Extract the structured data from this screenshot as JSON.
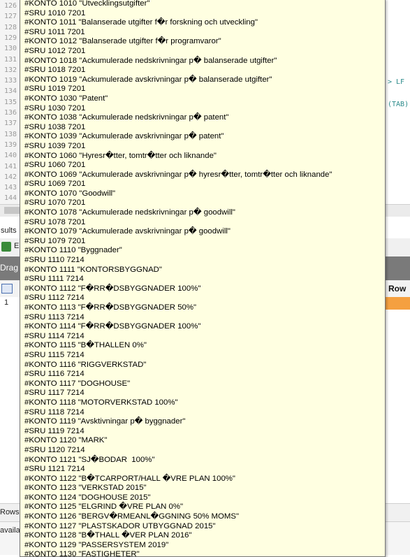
{
  "editor": {
    "line_numbers": [
      "126",
      "127",
      "128",
      "129",
      "130",
      "131",
      "132",
      "133",
      "134",
      "135",
      "136",
      "137",
      "138",
      "139",
      "140",
      "141",
      "142",
      "143",
      "144"
    ],
    "side_fragments": [
      "> LF",
      "(TAB)"
    ]
  },
  "results": {
    "tab_label": "sults",
    "toolbar_label": "E",
    "drag_label": "Drag",
    "column_header": "Row",
    "row_number": "1",
    "bottom_tab_label": "Rows",
    "status_label": "availa"
  },
  "tooltip": {
    "lines": [
      "#KONTO 1010 \"Utvecklingsutgifter\"",
      "#SRU 1010 7201",
      "#KONTO 1011 \"Balanserade utgifter f�r forskning och utveckling\"",
      "#SRU 1011 7201",
      "#KONTO 1012 \"Balanserade utgifter f�r programvaror\"",
      "#SRU 1012 7201",
      "#KONTO 1018 \"Ackumulerade nedskrivningar p� balanserade utgifter\"",
      "#SRU 1018 7201",
      "#KONTO 1019 \"Ackumulerade avskrivningar p� balanserade utgifter\"",
      "#SRU 1019 7201",
      "#KONTO 1030 \"Patent\"",
      "#SRU 1030 7201",
      "#KONTO 1038 \"Ackumulerade nedskrivningar p� patent\"",
      "#SRU 1038 7201",
      "#KONTO 1039 \"Ackumulerade avskrivningar p� patent\"",
      "#SRU 1039 7201",
      "#KONTO 1060 \"Hyresr�tter, tomtr�tter och liknande\"",
      "#SRU 1060 7201",
      "#KONTO 1069 \"Ackumulerade avskrivningar p� hyresr�tter, tomtr�tter och liknande\"",
      "#SRU 1069 7201",
      "#KONTO 1070 \"Goodwill\"",
      "#SRU 1070 7201",
      "#KONTO 1078 \"Ackumulerade nedskrivningar p� goodwill\"",
      "#SRU 1078 7201",
      "#KONTO 1079 \"Ackumulerade avskrivningar p� goodwill\"",
      "#SRU 1079 7201",
      "#KONTO 1110 \"Byggnader\"",
      "#SRU 1110 7214",
      "#KONTO 1111 \"KONTORSBYGGNAD\"",
      "#SRU 1111 7214",
      "#KONTO 1112 \"F�RR�DSBYGGNADER 100%\"",
      "#SRU 1112 7214",
      "#KONTO 1113 \"F�RR�DSBYGGNADER 50%\"",
      "#SRU 1113 7214",
      "#KONTO 1114 \"F�RR�DSBYGGNADER 100%\"",
      "#SRU 1114 7214",
      "#KONTO 1115 \"B�THALLEN 0%\"",
      "#SRU 1115 7214",
      "#KONTO 1116 \"RIGGVERKSTAD\"",
      "#SRU 1116 7214",
      "#KONTO 1117 \"DOGHOUSE\"",
      "#SRU 1117 7214",
      "#KONTO 1118 \"MOTORVERKSTAD 100%\"",
      "#SRU 1118 7214",
      "#KONTO 1119 \"Avsktivningar p� byggnader\"",
      "#SRU 1119 7214",
      "#KONTO 1120 \"MARK\"",
      "#SRU 1120 7214",
      "#KONTO 1121 \"SJ�BODAR  100%\"",
      "#SRU 1121 7214",
      "#KONTO 1122 \"B�TCARPORT/HALL �VRE PLAN 100%\"",
      "#KONTO 1123 \"VERKSTAD 2015\"",
      "#KONTO 1124 \"DOGHOUSE 2015\"",
      "#KONTO 1125 \"ELGRIND �VRE PLAN 0%\"",
      "#KONTO 1126 \"BERGV�RMEANL�GGNING 50% MOMS\"",
      "#KONTO 1127 \"PLASTSKADOR UTBYGGNAD 2015\"",
      "#KONTO 1128 \"B�THALL �VER PLAN 2016\"",
      "#KONTO 1129 \"PASSERSYSTEM 2019\"",
      "#KONTO 1130 \"FASTIGHETER\""
    ]
  }
}
